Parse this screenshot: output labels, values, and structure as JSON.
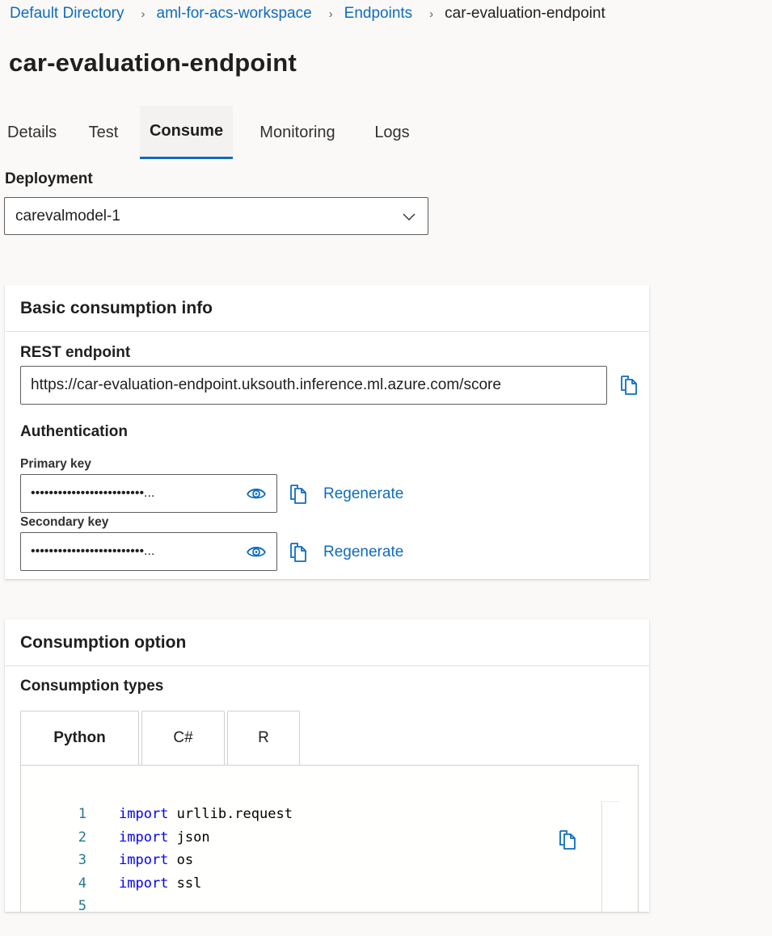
{
  "breadcrumb": {
    "items": [
      {
        "label": "Default Directory",
        "link": true
      },
      {
        "label": "aml-for-acs-workspace",
        "link": true
      },
      {
        "label": "Endpoints",
        "link": true
      },
      {
        "label": "car-evaluation-endpoint",
        "link": false
      }
    ],
    "separator": "›"
  },
  "page": {
    "title": "car-evaluation-endpoint"
  },
  "tabs": [
    {
      "label": "Details",
      "active": false
    },
    {
      "label": "Test",
      "active": false
    },
    {
      "label": "Consume",
      "active": true
    },
    {
      "label": "Monitoring",
      "active": false
    },
    {
      "label": "Logs",
      "active": false
    }
  ],
  "deployment": {
    "label": "Deployment",
    "selected": "carevalmodel-1"
  },
  "basic_info": {
    "title": "Basic consumption info",
    "rest_endpoint_label": "REST endpoint",
    "rest_endpoint_value": "https://car-evaluation-endpoint.uksouth.inference.ml.azure.com/score",
    "authentication_label": "Authentication",
    "primary_key_label": "Primary key",
    "primary_key_masked": "•••••••••••••••••••••••••...",
    "secondary_key_label": "Secondary key",
    "secondary_key_masked": "•••••••••••••••••••••••••...",
    "regenerate_label": "Regenerate"
  },
  "consumption_option": {
    "title": "Consumption option",
    "types_label": "Consumption types",
    "language_tabs": [
      {
        "label": "Python",
        "active": true
      },
      {
        "label": "C#",
        "active": false
      },
      {
        "label": "R",
        "active": false
      }
    ],
    "code_lines": [
      {
        "num": "1",
        "keyword": "import",
        "rest": " urllib.request"
      },
      {
        "num": "2",
        "keyword": "import",
        "rest": " json"
      },
      {
        "num": "3",
        "keyword": "import",
        "rest": " os"
      },
      {
        "num": "4",
        "keyword": "import",
        "rest": " ssl"
      },
      {
        "num": "5",
        "keyword": "",
        "rest": ""
      }
    ]
  },
  "colors": {
    "accent": "#0f6cbd",
    "keyword": "#0000ff",
    "line_number": "#237893",
    "page_background": "#faf9f8"
  }
}
